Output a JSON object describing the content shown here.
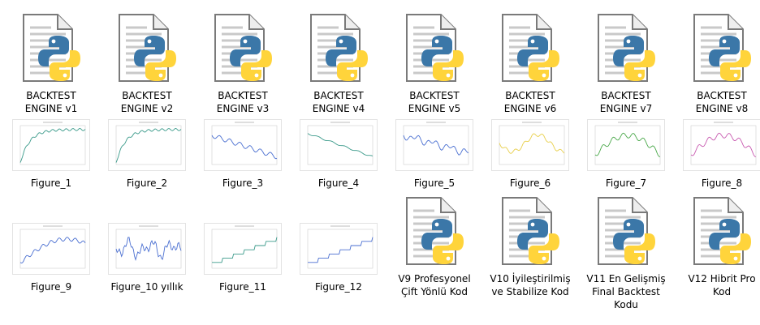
{
  "colors": {
    "python_blue": "#3b77a8",
    "python_yellow": "#ffd43b",
    "doc_edge": "#7a7a7a",
    "thumb_line_blue": "#4a6fd1",
    "thumb_line_yellow": "#e8cf4a",
    "thumb_line_green": "#4aa84a",
    "thumb_line_pink": "#c85ab0",
    "thumb_line_teal": "#3a9a8a"
  },
  "items": [
    {
      "label": "BACKTEST\nENGINE v1",
      "icon": "python-file-icon"
    },
    {
      "label": "BACKTEST\nENGINE v2",
      "icon": "python-file-icon"
    },
    {
      "label": "BACKTEST\nENGINE v3",
      "icon": "python-file-icon"
    },
    {
      "label": "BACKTEST\nENGINE v4",
      "icon": "python-file-icon"
    },
    {
      "label": "BACKTEST\nENGINE v5",
      "icon": "python-file-icon"
    },
    {
      "label": "BACKTEST\nENGINE v6",
      "icon": "python-file-icon"
    },
    {
      "label": "BACKTEST\nENGINE v7",
      "icon": "python-file-icon"
    },
    {
      "label": "BACKTEST\nENGINE v8",
      "icon": "python-file-icon"
    },
    {
      "label": "Figure_1",
      "icon": "chart-thumbnail-icon"
    },
    {
      "label": "Figure_2",
      "icon": "chart-thumbnail-icon"
    },
    {
      "label": "Figure_3",
      "icon": "chart-thumbnail-icon"
    },
    {
      "label": "Figure_4",
      "icon": "chart-thumbnail-icon"
    },
    {
      "label": "Figure_5",
      "icon": "chart-thumbnail-icon"
    },
    {
      "label": "Figure_6",
      "icon": "chart-thumbnail-icon"
    },
    {
      "label": "Figure_7",
      "icon": "chart-thumbnail-icon"
    },
    {
      "label": "Figure_8",
      "icon": "chart-thumbnail-icon"
    },
    {
      "label": "Figure_9",
      "icon": "chart-thumbnail-icon"
    },
    {
      "label": "Figure_10 yıllık",
      "icon": "chart-thumbnail-icon"
    },
    {
      "label": "Figure_11",
      "icon": "chart-thumbnail-icon"
    },
    {
      "label": "Figure_12",
      "icon": "chart-thumbnail-icon"
    },
    {
      "label": "V9 Profesyonel\nÇift Yönlü Kod",
      "icon": "python-file-icon"
    },
    {
      "label": "V10 İyileştirilmiş\nve Stabilize Kod",
      "icon": "python-file-icon"
    },
    {
      "label": "V11 En Gelişmiş\nFinal Backtest\nKodu",
      "icon": "python-file-icon"
    },
    {
      "label": "V12 Hibrit Pro\nKod",
      "icon": "python-file-icon"
    }
  ]
}
